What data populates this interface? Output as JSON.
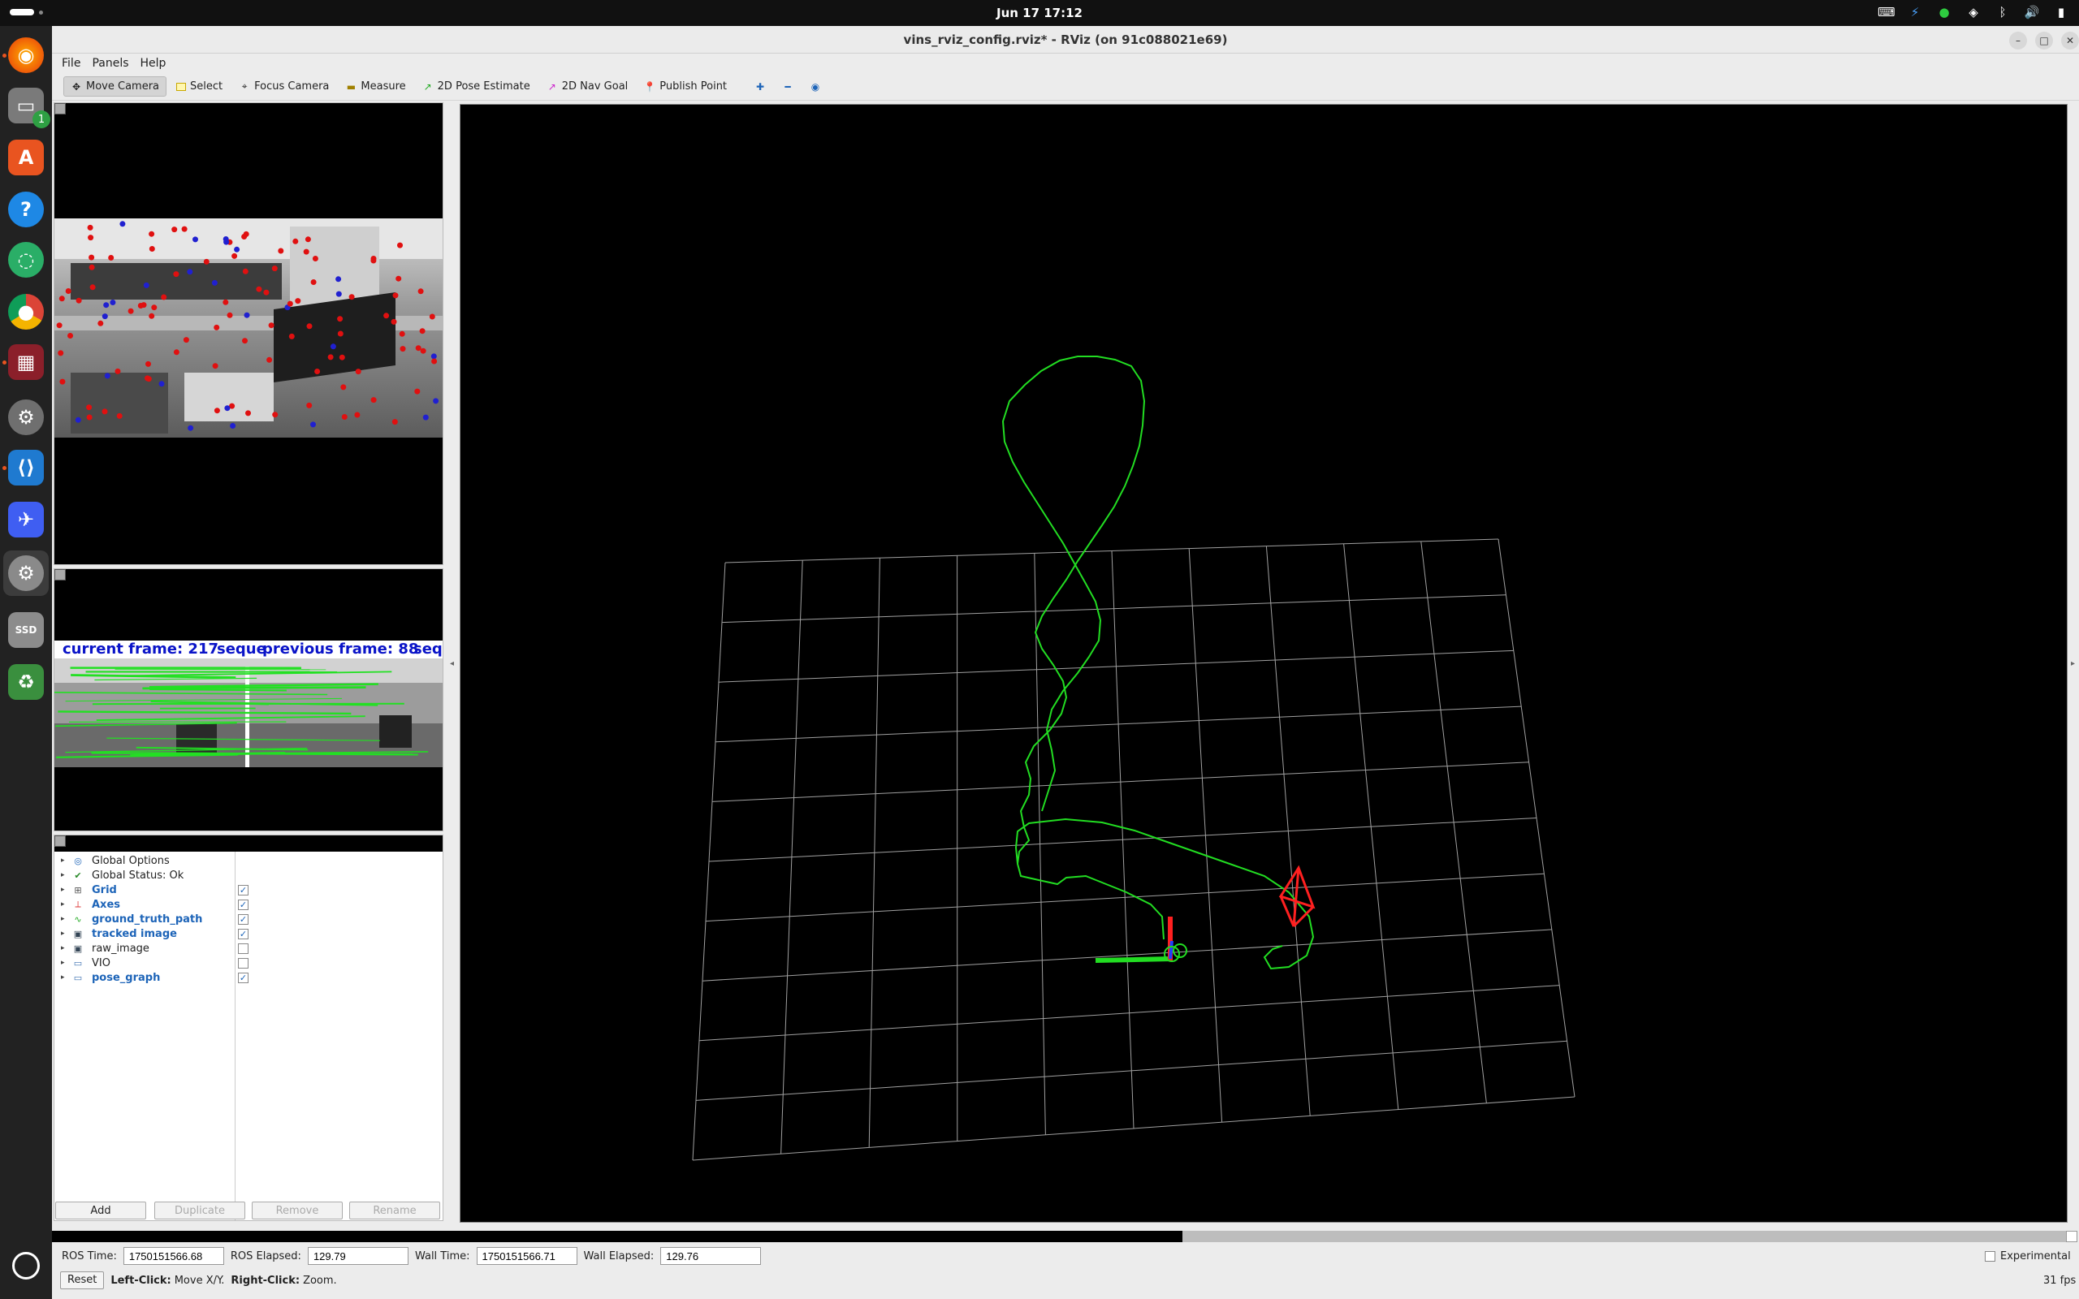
{
  "topbar": {
    "clock": "Jun 17  17:12"
  },
  "dock": {
    "badge": "1"
  },
  "window": {
    "title": "vins_rviz_config.rviz* - RViz (on 91c088021e69)"
  },
  "menu": [
    "File",
    "Panels",
    "Help"
  ],
  "toolbar": {
    "move_camera": "Move Camera",
    "select": "Select",
    "focus_camera": "Focus Camera",
    "measure": "Measure",
    "pose_estimate": "2D Pose Estimate",
    "nav_goal": "2D Nav Goal",
    "publish_point": "Publish Point"
  },
  "tracked_panel": {
    "current_frame": "current frame: 217",
    "sequence": "seque",
    "previous_frame": "previous frame: 88",
    "sequence2": "sequ"
  },
  "displays": [
    {
      "label": "Global Options",
      "icon": "globe-icon",
      "expandable": true,
      "checkbox": null,
      "highlight": false
    },
    {
      "label": "Global Status: Ok",
      "icon": "check-icon",
      "expandable": true,
      "checkbox": null,
      "highlight": false
    },
    {
      "label": "Grid",
      "icon": "grid-icon",
      "expandable": true,
      "checkbox": true,
      "highlight": true
    },
    {
      "label": "Axes",
      "icon": "axes-icon",
      "expandable": true,
      "checkbox": true,
      "highlight": true
    },
    {
      "label": "ground_truth_path",
      "icon": "path-icon",
      "expandable": true,
      "checkbox": true,
      "highlight": true
    },
    {
      "label": "tracked image",
      "icon": "image-icon",
      "expandable": true,
      "checkbox": true,
      "highlight": true
    },
    {
      "label": "raw_image",
      "icon": "image-icon",
      "expandable": true,
      "checkbox": false,
      "highlight": false
    },
    {
      "label": "VIO",
      "icon": "folder-icon",
      "expandable": true,
      "checkbox": false,
      "highlight": false
    },
    {
      "label": "pose_graph",
      "icon": "folder-icon",
      "expandable": true,
      "checkbox": true,
      "highlight": true
    }
  ],
  "buttons": {
    "add": "Add",
    "duplicate": "Duplicate",
    "remove": "Remove",
    "rename": "Rename"
  },
  "timebar": {
    "ros_time_label": "ROS Time:",
    "ros_time": "1750151566.68",
    "ros_elapsed_label": "ROS Elapsed:",
    "ros_elapsed": "129.79",
    "wall_time_label": "Wall Time:",
    "wall_time": "1750151566.71",
    "wall_elapsed_label": "Wall Elapsed:",
    "wall_elapsed": "129.76",
    "experimental": "Experimental"
  },
  "status": {
    "reset": "Reset",
    "left_click": "Left-Click:",
    "left_desc": "Move X/Y.",
    "right_click": "Right-Click:",
    "right_desc": "Zoom.",
    "fps": "31 fps"
  },
  "colors": {
    "path": "#22dd22",
    "camera": "#ff2020",
    "grid": "#a0a0a0",
    "tracked_text": "#0a14c8"
  }
}
